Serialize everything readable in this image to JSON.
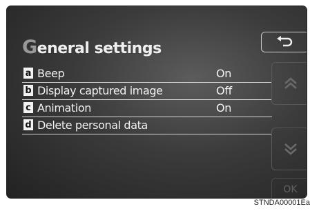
{
  "header": {
    "title_first_letter": "G",
    "title_rest": "eneral settings"
  },
  "settings": [
    {
      "letter": "a",
      "label": "Beep",
      "value": "On"
    },
    {
      "letter": "b",
      "label": "Display captured image",
      "value": "Off"
    },
    {
      "letter": "c",
      "label": "Animation",
      "value": "On"
    },
    {
      "letter": "d",
      "label": "Delete personal data",
      "value": ""
    }
  ],
  "buttons": {
    "back_icon": "return-arrow-icon",
    "up_icon": "double-chevron-up-icon",
    "down_icon": "double-chevron-down-icon",
    "ok_label": "OK"
  },
  "figure_code": "STNDA00001Ea"
}
